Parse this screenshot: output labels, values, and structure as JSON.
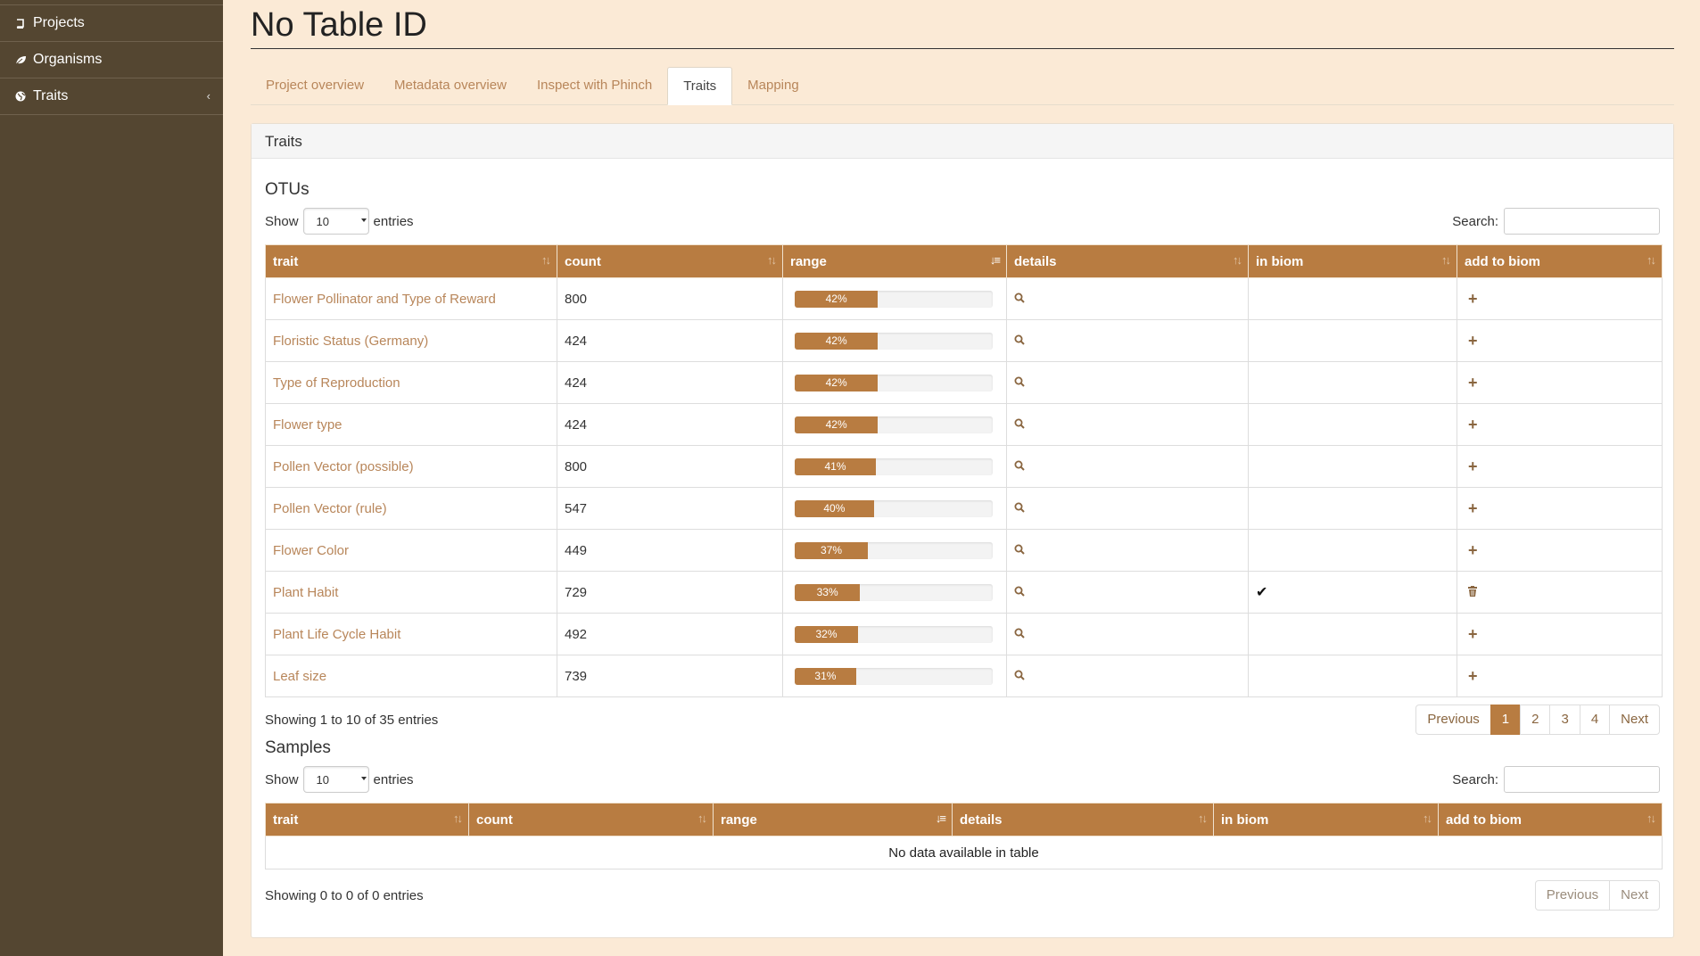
{
  "sidebar": {
    "items": [
      {
        "label": "Projects",
        "icon": "book-icon"
      },
      {
        "label": "Organisms",
        "icon": "leaf-icon"
      },
      {
        "label": "Traits",
        "icon": "globe-icon"
      }
    ]
  },
  "page": {
    "title": "No Table ID"
  },
  "tabs": [
    {
      "label": "Project overview"
    },
    {
      "label": "Metadata overview"
    },
    {
      "label": "Inspect with Phinch"
    },
    {
      "label": "Traits",
      "active": true
    },
    {
      "label": "Mapping"
    }
  ],
  "panel": {
    "title": "Traits"
  },
  "otus": {
    "title": "OTUs",
    "show_label": "Show",
    "entries_label": "entries",
    "page_size": "10",
    "search_label": "Search:",
    "columns": [
      "trait",
      "count",
      "range",
      "details",
      "in biom",
      "add to biom"
    ],
    "rows": [
      {
        "trait": "Flower Pollinator and Type of Reward",
        "count": "800",
        "range": "42%",
        "in_biom": false
      },
      {
        "trait": "Floristic Status (Germany)",
        "count": "424",
        "range": "42%",
        "in_biom": false
      },
      {
        "trait": "Type of Reproduction",
        "count": "424",
        "range": "42%",
        "in_biom": false
      },
      {
        "trait": "Flower type",
        "count": "424",
        "range": "42%",
        "in_biom": false
      },
      {
        "trait": "Pollen Vector (possible)",
        "count": "800",
        "range": "41%",
        "in_biom": false
      },
      {
        "trait": "Pollen Vector (rule)",
        "count": "547",
        "range": "40%",
        "in_biom": false
      },
      {
        "trait": "Flower Color",
        "count": "449",
        "range": "37%",
        "in_biom": false
      },
      {
        "trait": "Plant Habit",
        "count": "729",
        "range": "33%",
        "in_biom": true
      },
      {
        "trait": "Plant Life Cycle Habit",
        "count": "492",
        "range": "32%",
        "in_biom": false
      },
      {
        "trait": "Leaf size",
        "count": "739",
        "range": "31%",
        "in_biom": false
      }
    ],
    "info": "Showing 1 to 10 of 35 entries",
    "pager": {
      "previous": "Previous",
      "pages": [
        "1",
        "2",
        "3",
        "4"
      ],
      "current": "1",
      "next": "Next"
    }
  },
  "samples": {
    "title": "Samples",
    "show_label": "Show",
    "entries_label": "entries",
    "page_size": "10",
    "search_label": "Search:",
    "columns": [
      "trait",
      "count",
      "range",
      "details",
      "in biom",
      "add to biom"
    ],
    "empty": "No data available in table",
    "info": "Showing 0 to 0 of 0 entries",
    "pager": {
      "previous": "Previous",
      "next": "Next"
    }
  },
  "colors": {
    "accent": "#b87c41",
    "sidebar": "#544631",
    "background": "#fbead6",
    "link": "#b8865a"
  }
}
